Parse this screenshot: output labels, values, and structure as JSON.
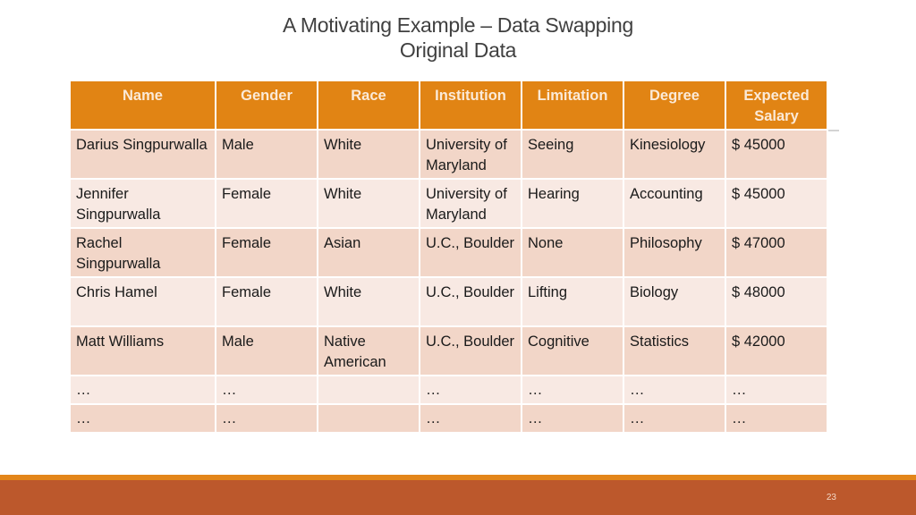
{
  "slide": {
    "title_line1": "A Motivating Example – Data Swapping",
    "title_line2": "Original Data",
    "page_number": "23"
  },
  "colors": {
    "header_bg": "#e18414",
    "row_odd_bg": "#f2d6c8",
    "row_even_bg": "#f8e9e3",
    "footer_bg": "#bc582c",
    "footer_stripe": "#e3861a"
  },
  "table": {
    "headers": [
      "Name",
      "Gender",
      "Race",
      "Institution",
      "Limitation",
      "Degree",
      "Expected Salary"
    ],
    "rows": [
      [
        "Darius Singpurwalla",
        "Male",
        "White",
        "University of Maryland",
        "Seeing",
        "Kinesiology",
        "$ 45000"
      ],
      [
        "Jennifer Singpurwalla",
        "Female",
        "White",
        "University of Maryland",
        "Hearing",
        "Accounting",
        "$ 45000"
      ],
      [
        "Rachel Singpurwalla",
        "Female",
        "Asian",
        "U.C., Boulder",
        "None",
        "Philosophy",
        "$ 47000"
      ],
      [
        "Chris Hamel",
        "Female",
        "White",
        "U.C., Boulder",
        "Lifting",
        "Biology",
        "$ 48000"
      ],
      [
        "Matt Williams",
        "Male",
        "Native American",
        "U.C., Boulder",
        "Cognitive",
        "Statistics",
        "$ 42000"
      ],
      [
        "…",
        "…",
        "",
        "…",
        "…",
        "…",
        "…"
      ],
      [
        "…",
        "…",
        "",
        "…",
        "…",
        "…",
        "…"
      ]
    ]
  }
}
